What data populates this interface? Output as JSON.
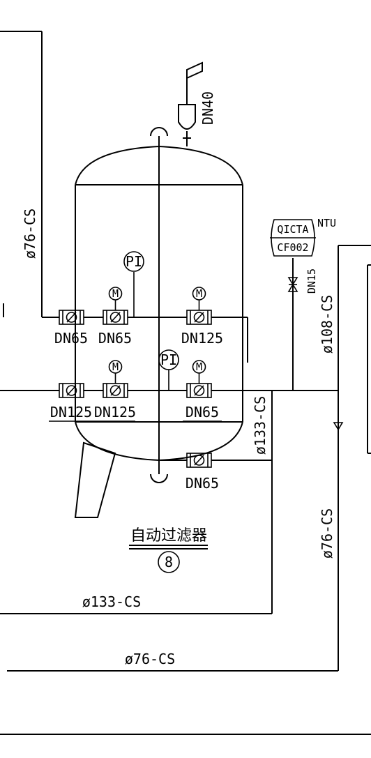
{
  "pipes": {
    "top_left_line": "ø76-CS",
    "right_branch_upper": "ø108-CS",
    "center_vertical": "ø133-CS",
    "right_vertical_lower": "ø76-CS",
    "bottom_mid": "ø133-CS",
    "bottom_long": "ø76-CS"
  },
  "vent": {
    "size": "DN40"
  },
  "instrument": {
    "tag_top": "QICTA",
    "tag_bottom": "CF002",
    "unit": "NTU",
    "valve_size": "DN15"
  },
  "gauges": {
    "pressure_1": "PI",
    "pressure_2": "PI"
  },
  "motors": {
    "m1": "M",
    "m2": "M",
    "m3": "M",
    "m4": "M"
  },
  "valves": {
    "upper_row": [
      "DN65",
      "DN65",
      "DN125"
    ],
    "lower_row": [
      "DN125",
      "DN125",
      "DN65"
    ],
    "bottom": "DN65"
  },
  "equipment": {
    "name": "自动过滤器",
    "number": "8"
  }
}
